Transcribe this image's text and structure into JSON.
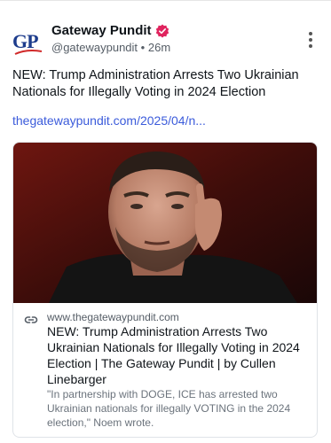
{
  "header": {
    "avatar_text": "GP",
    "display_name": "Gateway Pundit",
    "handle": "@gatewaypundit",
    "separator": "•",
    "time": "26m"
  },
  "post": {
    "text": "NEW: Trump Administration Arrests Two Ukrainian Nationals for Illegally Voting in 2024 Election",
    "link": "thegatewaypundit.com/2025/04/n..."
  },
  "card": {
    "domain": "www.thegatewaypundit.com",
    "title": "NEW: Trump Administration Arrests Two Ukrainian Nationals for Illegally Voting in 2024 Election | The Gateway Pundit | by Cullen Linebarger",
    "description": "\"In partnership with DOGE, ICE has arrested two Ukrainian nationals for illegally VOTING in the 2024 election,\" Noem wrote."
  },
  "colors": {
    "link": "#3b5bdb",
    "verified_badge": "#e0245e",
    "brand_blue": "#1d3c8c",
    "brand_red": "#d12a2a"
  },
  "icons": [
    "verified-badge-icon",
    "more-options-icon",
    "link-icon"
  ]
}
